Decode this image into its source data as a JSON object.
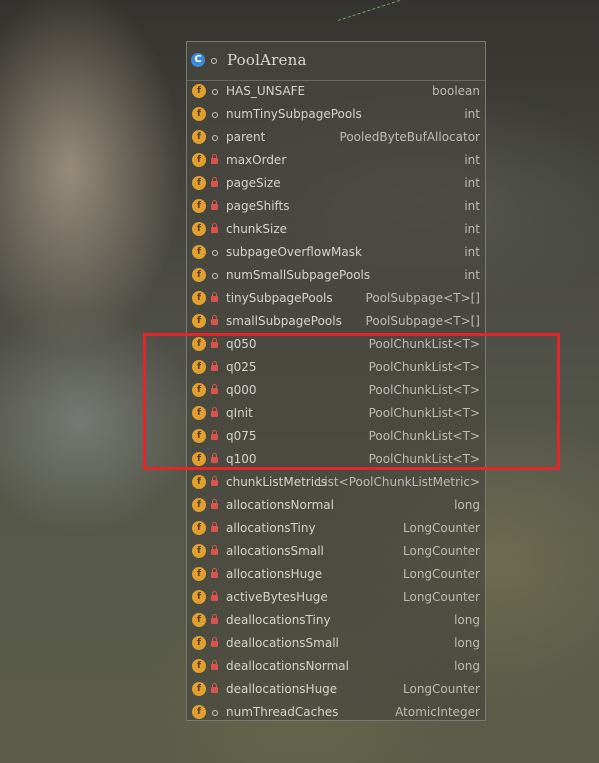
{
  "popup": {
    "title": "PoolArena",
    "class_icon": "class-icon",
    "class_icon_letter": "C"
  },
  "fields": [
    {
      "name": "HAS_UNSAFE",
      "type": "boolean",
      "visibility": "public"
    },
    {
      "name": "numTinySubpagePools",
      "type": "int",
      "visibility": "public"
    },
    {
      "name": "parent",
      "type": "PooledByteBufAllocator",
      "visibility": "public"
    },
    {
      "name": "maxOrder",
      "type": "int",
      "visibility": "private"
    },
    {
      "name": "pageSize",
      "type": "int",
      "visibility": "private"
    },
    {
      "name": "pageShifts",
      "type": "int",
      "visibility": "private"
    },
    {
      "name": "chunkSize",
      "type": "int",
      "visibility": "private"
    },
    {
      "name": "subpageOverflowMask",
      "type": "int",
      "visibility": "public"
    },
    {
      "name": "numSmallSubpagePools",
      "type": "int",
      "visibility": "public"
    },
    {
      "name": "tinySubpagePools",
      "type": "PoolSubpage<T>[]",
      "visibility": "private"
    },
    {
      "name": "smallSubpagePools",
      "type": "PoolSubpage<T>[]",
      "visibility": "private"
    },
    {
      "name": "q050",
      "type": "PoolChunkList<T>",
      "visibility": "private"
    },
    {
      "name": "q025",
      "type": "PoolChunkList<T>",
      "visibility": "private"
    },
    {
      "name": "q000",
      "type": "PoolChunkList<T>",
      "visibility": "private"
    },
    {
      "name": "qInit",
      "type": "PoolChunkList<T>",
      "visibility": "private"
    },
    {
      "name": "q075",
      "type": "PoolChunkList<T>",
      "visibility": "private"
    },
    {
      "name": "q100",
      "type": "PoolChunkList<T>",
      "visibility": "private"
    },
    {
      "name": "chunkListMetrics",
      "type": "List<PoolChunkListMetric>",
      "visibility": "private"
    },
    {
      "name": "allocationsNormal",
      "type": "long",
      "visibility": "private"
    },
    {
      "name": "allocationsTiny",
      "type": "LongCounter",
      "visibility": "private"
    },
    {
      "name": "allocationsSmall",
      "type": "LongCounter",
      "visibility": "private"
    },
    {
      "name": "allocationsHuge",
      "type": "LongCounter",
      "visibility": "private"
    },
    {
      "name": "activeBytesHuge",
      "type": "LongCounter",
      "visibility": "private"
    },
    {
      "name": "deallocationsTiny",
      "type": "long",
      "visibility": "private"
    },
    {
      "name": "deallocationsSmall",
      "type": "long",
      "visibility": "private"
    },
    {
      "name": "deallocationsNormal",
      "type": "long",
      "visibility": "private"
    },
    {
      "name": "deallocationsHuge",
      "type": "LongCounter",
      "visibility": "private"
    },
    {
      "name": "numThreadCaches",
      "type": "AtomicInteger",
      "visibility": "public"
    }
  ],
  "field_icon": "field-icon",
  "field_icon_letter": "f",
  "highlighted_fields": [
    "q050",
    "q025",
    "q000",
    "qInit",
    "q075",
    "q100"
  ],
  "colors": {
    "highlight": "#e4262b",
    "field_icon": "#e0a030",
    "class_icon": "#3d8bd8",
    "private_lock": "#d9534f"
  }
}
